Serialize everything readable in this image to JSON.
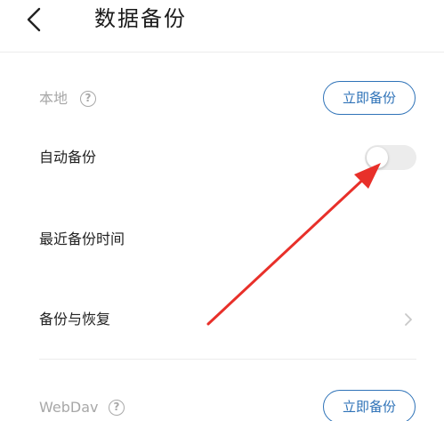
{
  "header": {
    "title": "数据备份"
  },
  "local": {
    "label": "本地",
    "backup_button": "立即备份"
  },
  "auto_backup": {
    "label": "自动备份",
    "enabled": false
  },
  "last_backup": {
    "label": "最近备份时间"
  },
  "backup_restore": {
    "label": "备份与恢复"
  },
  "webdav": {
    "label": "WebDav",
    "backup_button": "立即备份"
  },
  "icons": {
    "back": "chevron-left-icon",
    "help": "question-circle-icon",
    "chevron": "chevron-right-icon"
  },
  "colors": {
    "accent": "#2f73b8",
    "annotation_arrow": "#e8302a",
    "muted_text": "#a8a8a8",
    "toggle_off": "#ececec"
  }
}
